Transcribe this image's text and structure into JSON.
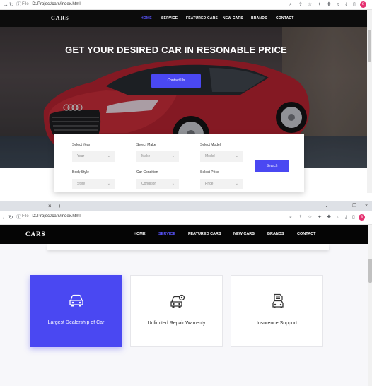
{
  "browser_top": {
    "file_label": "File",
    "url": "D:/Project/cars/index.html"
  },
  "browser_bottom": {
    "file_label": "File",
    "url": "D:/Project/cars/index.html"
  },
  "site": {
    "logo": "CARS",
    "nav": [
      "HOME",
      "SERVICE",
      "FEATURED CARS",
      "NEW CARS",
      "BRANDS",
      "CONTACT"
    ]
  },
  "page1": {
    "active_nav": "HOME",
    "hero_title": "GET YOUR DESIRED CAR IN RESONABLE PRICE",
    "contact_button": "Contact Us",
    "search": {
      "fields": [
        {
          "label": "Select Year",
          "value": "Year"
        },
        {
          "label": "Select Make",
          "value": "Make"
        },
        {
          "label": "Select Model",
          "value": "Model"
        },
        {
          "label": "Body Style",
          "value": "Style"
        },
        {
          "label": "Car Condition",
          "value": "Condition"
        },
        {
          "label": "Select Price",
          "value": "Price"
        }
      ],
      "button": "Search"
    }
  },
  "page2": {
    "active_nav": "SERVICE",
    "services": [
      {
        "label": "Largest Dealership of Car",
        "icon": "car-icon",
        "featured": true
      },
      {
        "label": "Unlimited Repair Warrenty",
        "icon": "car-repair-icon",
        "featured": false
      },
      {
        "label": "Insurence Support",
        "icon": "car-insurance-icon",
        "featured": false
      }
    ]
  },
  "colors": {
    "accent": "#4a48f2",
    "nav_bg": "#0c0c0c",
    "car_red": "#a9202d"
  }
}
